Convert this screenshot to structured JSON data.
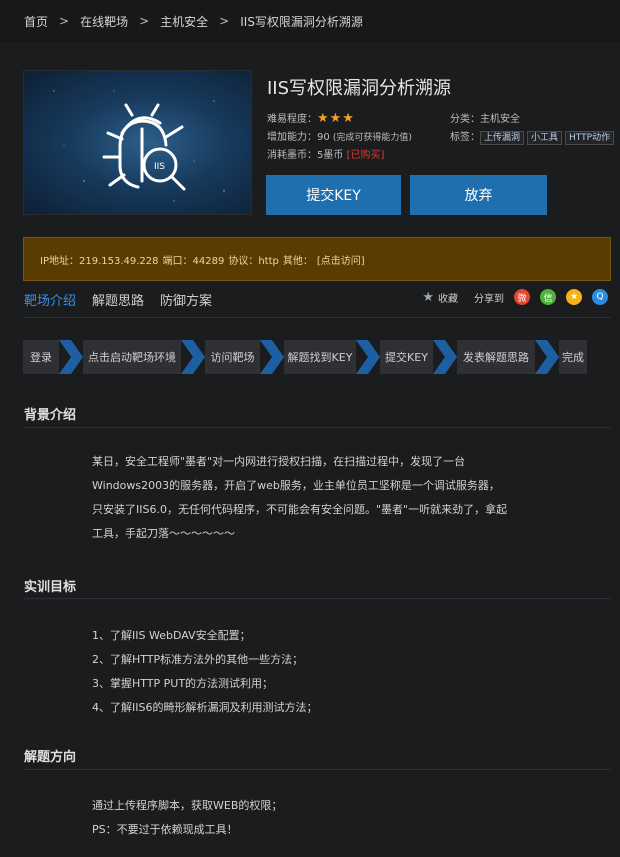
{
  "breadcrumb": [
    "首页",
    "在线靶场",
    "主机安全",
    "IIS写权限漏洞分析溯源"
  ],
  "title": "IIS写权限漏洞分析溯源",
  "meta": {
    "difficulty_label": "难易程度：",
    "difficulty_stars": "★★★",
    "ability_label": "增加能力：90",
    "ability_note": "(完成可获得能力值)",
    "cost_label": "消耗墨币：5墨币",
    "cost_status": "[已购买]",
    "category": "分类：主机安全",
    "tags_label": "标签：",
    "tags": [
      "上传漏洞",
      "小工具",
      "HTTP动作"
    ]
  },
  "buttons": {
    "submit": "提交KEY",
    "abandon": "放弃"
  },
  "info": {
    "ip": "IP地址：219.153.49.228",
    "port": "端口：44289",
    "protocol": "协议：http",
    "other": "其他：",
    "link": "[点击访问]"
  },
  "tabs": [
    "靶场介绍",
    "解题思路",
    "防御方案"
  ],
  "social": {
    "favorite": "收藏",
    "share": "分享到"
  },
  "steps": [
    "登录",
    "点击启动靶场环境",
    "访问靶场",
    "解题找到KEY",
    "提交KEY",
    "发表解题思路",
    "完成"
  ],
  "sections": {
    "background": {
      "title": "背景介绍",
      "lines": [
        "某日，安全工程师\"墨者\"对一内网进行授权扫描，在扫描过程中，发现了一台",
        "Windows2003的服务器，开启了web服务，业主单位员工坚称是一个调试服务器，",
        "只安装了IIS6.0，无任何代码程序，不可能会有安全问题。\"墨者\"一听就来劲了，拿起",
        "工具，手起刀落～～～～～～"
      ]
    },
    "goals": {
      "title": "实训目标",
      "items": [
        "1、了解IIS WebDAV安全配置；",
        "2、了解HTTP标准方法外的其他一些方法；",
        "3、掌握HTTP PUT的方法测试利用；",
        "4、了解IIS6的畸形解析漏洞及利用测试方法；"
      ]
    },
    "direction": {
      "title": "解题方向",
      "lines": [
        "通过上传程序脚本，获取WEB的权限；",
        "PS：不要过于依赖现成工具！"
      ]
    }
  }
}
